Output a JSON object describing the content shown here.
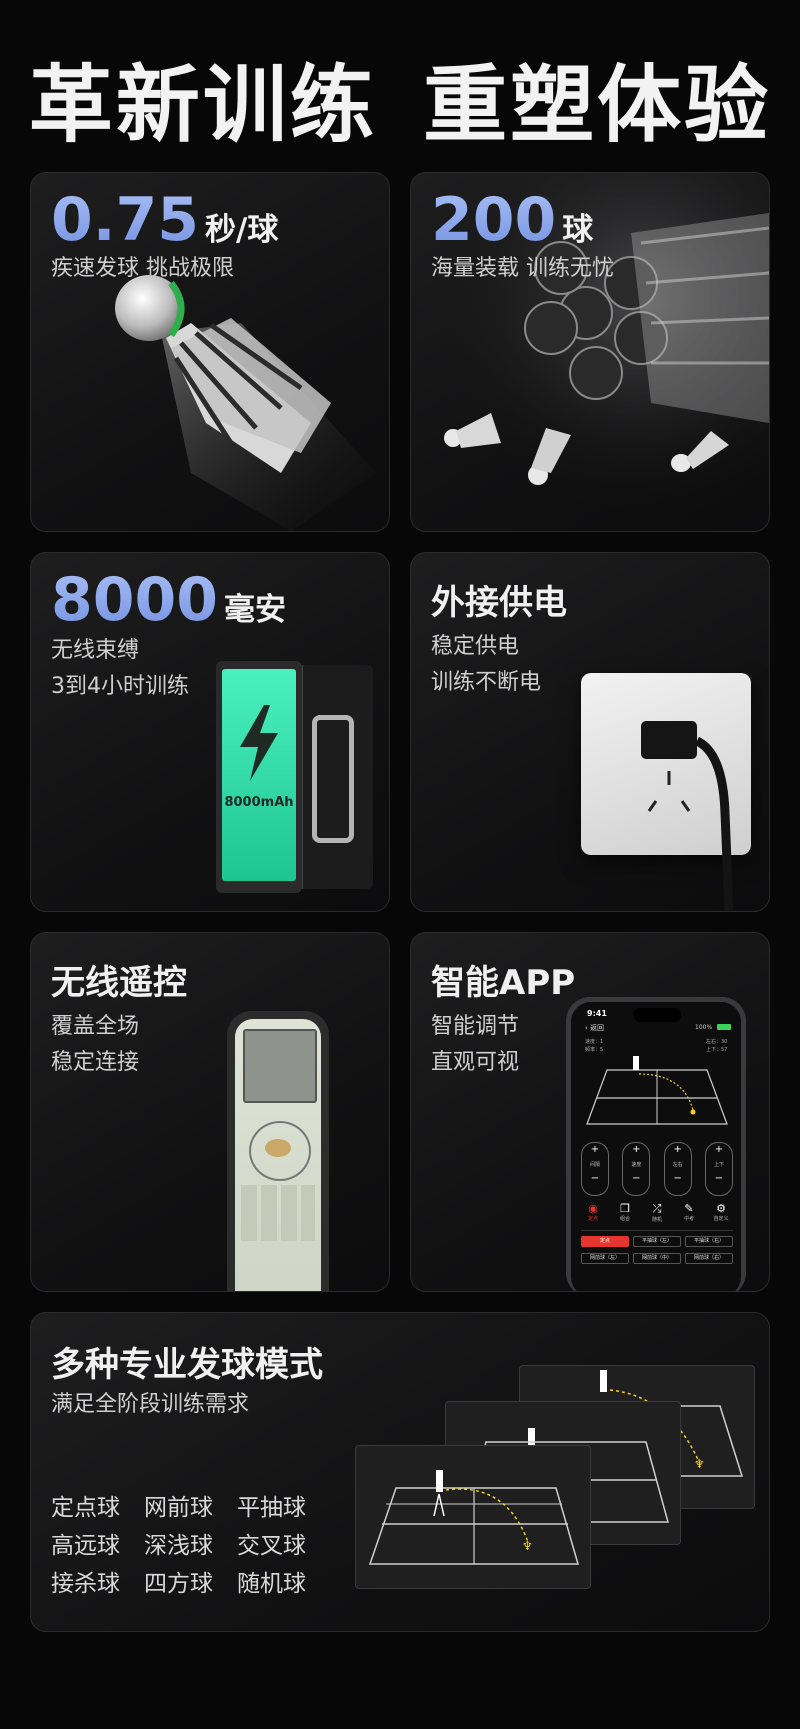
{
  "page_title": "革新训练  重塑体验",
  "speed": {
    "number": "0.75",
    "unit": "秒/球",
    "sub": "疾速发球  挑战极限"
  },
  "capacity": {
    "number": "200",
    "unit": "球",
    "sub": "海量装载  训练无忧"
  },
  "battery": {
    "number": "8000",
    "unit": "毫安",
    "sub1": "无线束缚",
    "sub2": "3到4小时训练",
    "pack_label": "8000mAh"
  },
  "power": {
    "heading": "外接供电",
    "sub1": "稳定供电",
    "sub2": "训练不断电"
  },
  "remote": {
    "heading": "无线遥控",
    "sub1": "覆盖全场",
    "sub2": "稳定连接"
  },
  "app": {
    "heading": "智能APP",
    "sub1": "智能调节",
    "sub2": "直观可视",
    "phone": {
      "time": "9:41",
      "battery": "100%",
      "back": "返回",
      "stat_left1": "速度：1",
      "stat_left2": "频率：5",
      "stat_right1": "左右：30",
      "stat_right2": "上下：57",
      "knobs": [
        "间隔",
        "速度",
        "左右",
        "上下"
      ],
      "tools": [
        "定点",
        "组合",
        "随机",
        "中考",
        "自定义"
      ],
      "chips": [
        "定点",
        "平抽球（左）",
        "平抽球（右）",
        "网前球（左）",
        "网前球（中）",
        "网前球（右）"
      ]
    }
  },
  "modes": {
    "heading": "多种专业发球模式",
    "sub": "满足全阶段训练需求",
    "items": [
      "定点球",
      "网前球",
      "平抽球",
      "高远球",
      "深浅球",
      "交叉球",
      "接杀球",
      "四方球",
      "随机球"
    ]
  },
  "colors": {
    "accent": "#8aa6ea",
    "battery_green": "#3ee6b0",
    "app_red": "#e5352f",
    "shuttle_yellow": "#f0d21a"
  }
}
